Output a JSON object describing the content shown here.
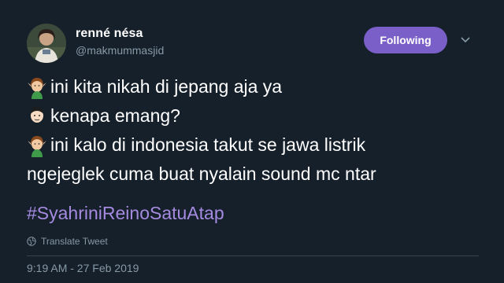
{
  "author": {
    "display_name": "renné nésa",
    "handle": "@makmummasjid"
  },
  "follow_button": {
    "label": "Following"
  },
  "tweet": {
    "lines": [
      {
        "speaker_icon": "woman-elf-emoji",
        "text": "ini kita nikah di jepang aja ya"
      },
      {
        "speaker_icon": "man-face-emoji",
        "text": "kenapa emang?"
      },
      {
        "speaker_icon": "woman-elf-emoji",
        "text": "ini kalo di indonesia takut se jawa listrik"
      },
      {
        "speaker_icon": "",
        "text": "ngejeglek cuma buat nyalain sound mc ntar"
      }
    ],
    "hashtag": "#SyahriniReinoSatuAtap",
    "translate_label": "Translate Tweet",
    "timestamp": "9:19 AM - 27 Feb 2019"
  },
  "colors": {
    "background": "#15202b",
    "follow_button": "#7a5fc8",
    "hashtag": "#a58ae0",
    "secondary_text": "#8899a6"
  }
}
